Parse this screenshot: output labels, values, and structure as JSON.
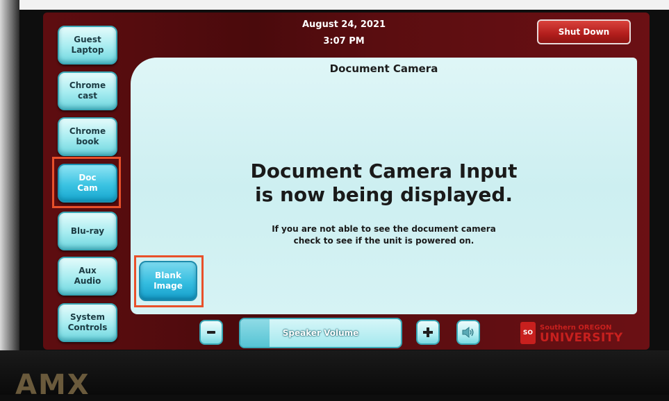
{
  "header": {
    "date": "August 24, 2021",
    "time": "3:07 PM",
    "shutdown_label": "Shut Down"
  },
  "sources": [
    {
      "label": "Guest\nLaptop",
      "active": false
    },
    {
      "label": "Chrome\ncast",
      "active": false
    },
    {
      "label": "Chrome\nbook",
      "active": false
    },
    {
      "label": "Doc\nCam",
      "active": true
    },
    {
      "label": "Blu-ray",
      "active": false
    },
    {
      "label": "Aux\nAudio",
      "active": false
    },
    {
      "label": "System\nControls",
      "active": false
    }
  ],
  "main": {
    "title": "Document Camera",
    "headline_line1": "Document Camera Input",
    "headline_line2": "is now being displayed.",
    "subtext_line1": "If you are not able to see the document camera",
    "subtext_line2": "check to see if the unit is powered on.",
    "blank_label_line1": "Blank",
    "blank_label_line2": "Image"
  },
  "volume": {
    "label": "Speaker Volume",
    "level": 0.18,
    "minus": "−",
    "plus": "+",
    "mute_icon": "speaker-icon"
  },
  "branding": {
    "device": "AMX",
    "mark": "SO",
    "school_line1": "Southern OREGON",
    "school_line2": "UNIVERSITY",
    "accent": "#c8201e"
  },
  "colors": {
    "frame": "#5e0d10",
    "button": "#a6ecf0",
    "active_button": "#3bc3e2",
    "highlight": "#e8502a"
  }
}
